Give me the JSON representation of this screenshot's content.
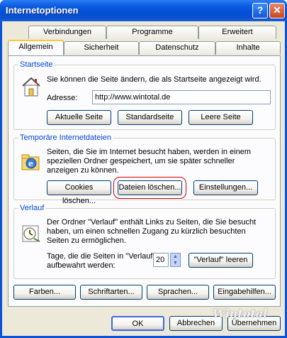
{
  "window": {
    "title": "Internetoptionen",
    "help_icon": "?",
    "close_icon": "✕"
  },
  "tabs": {
    "row1": [
      "Verbindungen",
      "Programme",
      "Erweitert"
    ],
    "row2": [
      "Allgemein",
      "Sicherheit",
      "Datenschutz",
      "Inhalte"
    ],
    "active": "Allgemein"
  },
  "startseite": {
    "title": "Startseite",
    "description": "Sie können die Seite ändern, die als Startseite angezeigt wird.",
    "address_label": "Adresse:",
    "address_value": "http://www.wintotal.de",
    "buttons": [
      "Aktuelle Seite",
      "Standardseite",
      "Leere Seite"
    ]
  },
  "temp_files": {
    "title": "Temporäre Internetdateien",
    "description_lines": [
      "Seiten, die Sie im Internet besucht haben, werden in einem",
      "speziellen Ordner gespeichert, um sie später schneller",
      "anzeigen zu können."
    ],
    "buttons": [
      "Cookies löschen...",
      "Dateien löschen...",
      "Einstellungen..."
    ]
  },
  "verlauf": {
    "title": "Verlauf",
    "description_lines": [
      "Der Ordner \"Verlauf\" enthält Links zu Seiten, die Sie besucht",
      "haben, um einen schnellen Zugang zu kürzlich besuchten",
      "Seiten zu ermöglichen."
    ],
    "days_label_lines": [
      "Tage, die die Seiten in \"Verlauf\"",
      "aufbewahrt werden:"
    ],
    "days_value": "20",
    "clear_button": "\"Verlauf\" leeren"
  },
  "bottom_buttons": [
    "Farben...",
    "Schriftarten...",
    "Sprachen...",
    "Eingabehilfen..."
  ],
  "dialog_buttons": [
    "OK",
    "Abbrechen",
    "Übernehmen"
  ],
  "watermark": "Wintotal",
  "colors": {
    "titlebar": "#0a53d8",
    "group_title": "#0046d5",
    "highlight": "#d40000",
    "dialog_bg": "#ece9d8"
  }
}
